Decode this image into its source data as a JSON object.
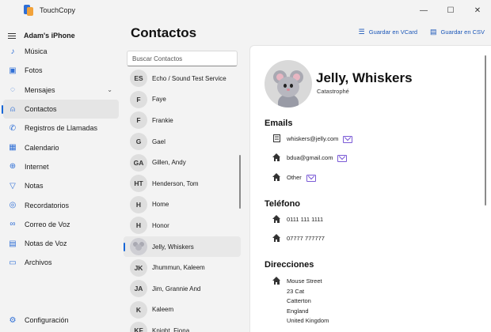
{
  "app": {
    "title": "TouchCopy"
  },
  "window_controls": {
    "minimize": "—",
    "maximize": "☐",
    "close": "✕"
  },
  "sidebar": {
    "device_name": "Adam's iPhone",
    "items": [
      {
        "label": "Música",
        "icon": "music-icon",
        "glyph": "♪"
      },
      {
        "label": "Fotos",
        "icon": "photos-icon",
        "glyph": "▣"
      },
      {
        "label": "Mensajes",
        "icon": "messages-icon",
        "glyph": "◌",
        "chevron": "⌄"
      },
      {
        "label": "Contactos",
        "icon": "contacts-icon",
        "glyph": "⍝",
        "active": true
      },
      {
        "label": "Registros de Llamadas",
        "icon": "phone-icon",
        "glyph": "✆"
      },
      {
        "label": "Calendario",
        "icon": "calendar-icon",
        "glyph": "▦"
      },
      {
        "label": "Internet",
        "icon": "globe-icon",
        "glyph": "⊕"
      },
      {
        "label": "Notas",
        "icon": "notes-icon",
        "glyph": "▽"
      },
      {
        "label": "Recordatorios",
        "icon": "reminders-icon",
        "glyph": "◎"
      },
      {
        "label": "Correo de Voz",
        "icon": "voicemail-icon",
        "glyph": "∞"
      },
      {
        "label": "Notas de Voz",
        "icon": "voice-notes-icon",
        "glyph": "▤"
      },
      {
        "label": "Archivos",
        "icon": "folder-icon",
        "glyph": "▭"
      }
    ],
    "settings": {
      "label": "Configuración",
      "glyph": "⚙"
    }
  },
  "main": {
    "title": "Contactos",
    "actions": {
      "vcard": {
        "label": "Guardar en VCard",
        "glyph": "☰"
      },
      "csv": {
        "label": "Guardar en CSV",
        "glyph": "▤"
      }
    },
    "search": {
      "placeholder": "Buscar Contactos"
    }
  },
  "contacts": [
    {
      "initials": "ES",
      "name": "Echo / Sound Test Service"
    },
    {
      "initials": "F",
      "name": "Faye"
    },
    {
      "initials": "F",
      "name": "Frankie"
    },
    {
      "initials": "G",
      "name": "Gael"
    },
    {
      "initials": "GA",
      "name": "Gillen, Andy"
    },
    {
      "initials": "HT",
      "name": "Henderson, Tom"
    },
    {
      "initials": "H",
      "name": "Home"
    },
    {
      "initials": "H",
      "name": "Honor"
    },
    {
      "initials": "",
      "name": "Jelly, Whiskers",
      "active": true
    },
    {
      "initials": "JK",
      "name": "Jhummun, Kaleem"
    },
    {
      "initials": "JA",
      "name": "Jim, Grannie And"
    },
    {
      "initials": "K",
      "name": "Kaleem"
    },
    {
      "initials": "KF",
      "name": "Knight, Fiona"
    }
  ],
  "detail": {
    "name": "Jelly, Whiskers",
    "company": "Catastrophé",
    "emails_title": "Emails",
    "emails": [
      {
        "type": "work",
        "value": "whiskers@jelly.com"
      },
      {
        "type": "home",
        "value": "bdua@gmail.com"
      },
      {
        "type": "home",
        "value": "Other"
      }
    ],
    "phone_title": "Teléfono",
    "phones": [
      {
        "type": "home",
        "value": "0111 111 1111"
      },
      {
        "type": "home",
        "value": "07777 777777"
      }
    ],
    "address_title": "Direcciones",
    "address": {
      "street": "Mouse Street",
      "line2": "23 Cat",
      "city": "Catterton",
      "region": "England",
      "country": "United Kingdom"
    }
  },
  "colors": {
    "accent": "#1866d6",
    "mail_icon": "#7b5bd6",
    "link": "#1a56b8"
  }
}
